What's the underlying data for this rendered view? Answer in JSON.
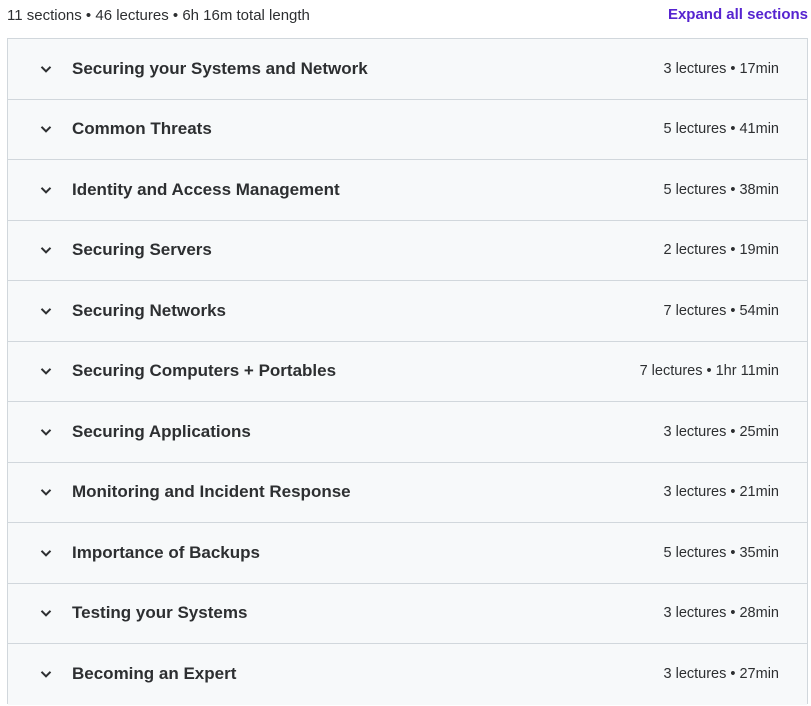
{
  "header": {
    "summary": "11 sections • 46 lectures • 6h 16m total length",
    "expand_all_label": "Expand all sections"
  },
  "colors": {
    "accent": "#5624d0",
    "row_background": "#f7f9fa",
    "border": "#d1d7dc",
    "text": "#2d2f31"
  },
  "icons": {
    "section_toggle": "chevron-down-icon"
  },
  "sections": [
    {
      "title": "Securing your Systems and Network",
      "meta": "3 lectures • 17min"
    },
    {
      "title": "Common Threats",
      "meta": "5 lectures • 41min"
    },
    {
      "title": "Identity and Access Management",
      "meta": "5 lectures • 38min"
    },
    {
      "title": "Securing Servers",
      "meta": "2 lectures • 19min"
    },
    {
      "title": "Securing Networks",
      "meta": "7 lectures • 54min"
    },
    {
      "title": "Securing Computers + Portables",
      "meta": "7 lectures • 1hr 11min"
    },
    {
      "title": "Securing Applications",
      "meta": "3 lectures • 25min"
    },
    {
      "title": "Monitoring and Incident Response",
      "meta": "3 lectures • 21min"
    },
    {
      "title": "Importance of Backups",
      "meta": "5 lectures • 35min"
    },
    {
      "title": "Testing your Systems",
      "meta": "3 lectures • 28min"
    },
    {
      "title": "Becoming an Expert",
      "meta": "3 lectures • 27min"
    }
  ]
}
